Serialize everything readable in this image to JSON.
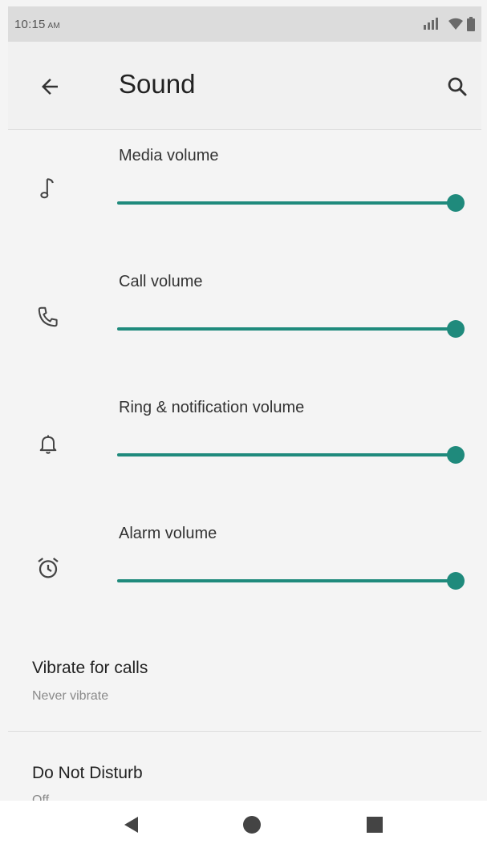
{
  "status_bar": {
    "time": "10:15",
    "ampm": "AM"
  },
  "app_bar": {
    "title": "Sound",
    "back_icon": "arrow-back-icon",
    "search_icon": "search-icon"
  },
  "volumes": [
    {
      "label": "Media volume",
      "icon": "music-note-icon",
      "level": 1.0
    },
    {
      "label": "Call volume",
      "icon": "phone-icon",
      "level": 1.0
    },
    {
      "label": "Ring & notification volume",
      "icon": "bell-icon",
      "level": 1.0
    },
    {
      "label": "Alarm volume",
      "icon": "alarm-clock-icon",
      "level": 1.0
    }
  ],
  "preferences": [
    {
      "title": "Vibrate for calls",
      "summary": "Never vibrate"
    },
    {
      "title": "Do Not Disturb",
      "summary": "Off"
    }
  ],
  "colors": {
    "accent": "#1f8a7c",
    "track": "#b9d8d3"
  },
  "nav_bar": {
    "back": "nav-back-icon",
    "home": "nav-home-icon",
    "recents": "nav-recents-icon"
  }
}
